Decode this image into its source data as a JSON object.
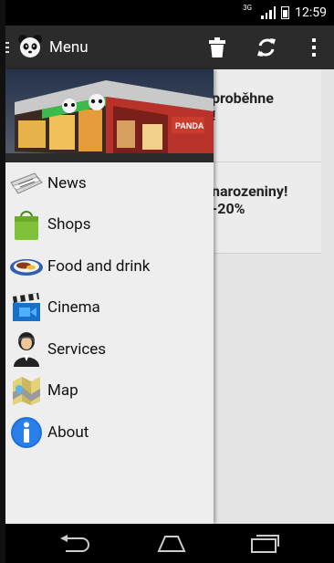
{
  "status_bar": {
    "network_type": "3G",
    "time": "12:59"
  },
  "action_bar": {
    "title": "Menu",
    "app_icon": "panda-logo-icon",
    "actions": [
      {
        "icon": "trash-icon"
      },
      {
        "icon": "refresh-icon"
      },
      {
        "icon": "overflow-menu-icon"
      }
    ]
  },
  "background_cards": [
    {
      "line1": "proběhne",
      "line2": "!"
    },
    {
      "line1": "narozeniny!",
      "line2": "-20%"
    }
  ],
  "drawer": {
    "header_image": "shopping-mall-building-photo",
    "items": [
      {
        "label": "News",
        "icon": "newspaper-icon"
      },
      {
        "label": "Shops",
        "icon": "shopping-bag-icon"
      },
      {
        "label": "Food and drink",
        "icon": "food-plate-icon"
      },
      {
        "label": "Cinema",
        "icon": "clapperboard-icon"
      },
      {
        "label": "Services",
        "icon": "service-person-icon"
      },
      {
        "label": "Map",
        "icon": "map-icon"
      },
      {
        "label": "About",
        "icon": "info-icon"
      }
    ]
  },
  "nav_bar": [
    {
      "icon": "back-icon"
    },
    {
      "icon": "home-icon"
    },
    {
      "icon": "recent-apps-icon"
    }
  ],
  "colors": {
    "action_bar": "#2b2b2b",
    "drawer_background": "#eeeeee",
    "status_bar": "#000000",
    "info_blue": "#1e6fd9"
  }
}
